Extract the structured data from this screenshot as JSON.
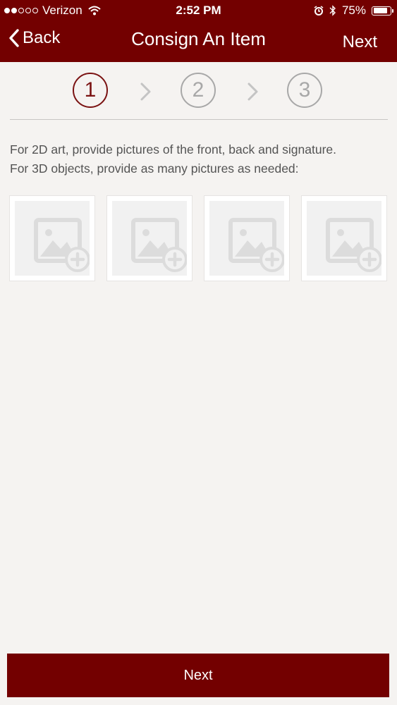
{
  "status_bar": {
    "carrier": "Verizon",
    "time": "2:52 PM",
    "battery_percent": "75%",
    "signal_bars": 2,
    "battery_level": 0.75
  },
  "nav": {
    "back_label": "Back",
    "title": "Consign An Item",
    "next_label": "Next"
  },
  "steps": [
    {
      "label": "1",
      "active": true
    },
    {
      "label": "2",
      "active": false
    },
    {
      "label": "3",
      "active": false
    }
  ],
  "instructions": {
    "line1": "For 2D art, provide pictures of the front, back and signature.",
    "line2": "For 3D objects, provide as many pictures as needed:"
  },
  "photo_slots": [
    {
      "icon": "add-photo-icon"
    },
    {
      "icon": "add-photo-icon"
    },
    {
      "icon": "add-photo-icon"
    },
    {
      "icon": "add-photo-icon"
    }
  ],
  "footer": {
    "next_button_label": "Next"
  },
  "colors": {
    "brand": "#730000",
    "background": "#f5f3f1",
    "step_inactive": "#a8a8a8"
  }
}
